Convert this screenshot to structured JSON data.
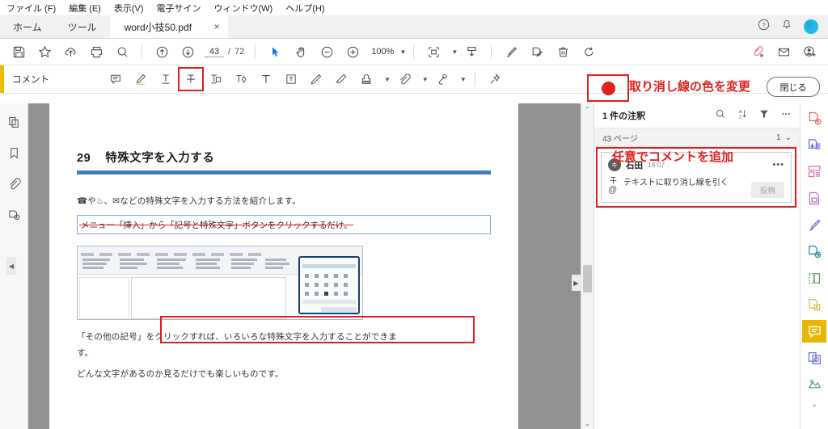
{
  "menubar": {
    "items": [
      "ファイル (F)",
      "編集 (E)",
      "表示(V)",
      "電子サイン",
      "ウィンドウ(W)",
      "ヘルプ(H)"
    ]
  },
  "tabbar": {
    "home": "ホーム",
    "tools": "ツール",
    "document_tab": "word小技50.pdf",
    "close_tab": "×",
    "icons": [
      "help-icon",
      "bell-icon",
      "user-avatar"
    ]
  },
  "toolbar": {
    "icons": [
      "save-icon",
      "star-icon",
      "cloud-upload-icon",
      "print-icon",
      "search-icon",
      "page-up-icon",
      "page-down-icon",
      "select-tool-icon",
      "hand-tool-icon",
      "zoom-out-icon",
      "zoom-in-icon",
      "fit-page-icon",
      "download-page-icon",
      "sign-icon",
      "edit-sign-icon",
      "delete-icon",
      "rotate-icon",
      "share-link-icon",
      "email-icon",
      "add-person-icon"
    ],
    "page_current": "43",
    "page_separator": "/",
    "page_total": "72",
    "zoom_level": "100%"
  },
  "comment_toolbar": {
    "label": "コメント",
    "tools": [
      "sticky-note-icon",
      "highlighter-icon",
      "underline-icon",
      "strikethrough-icon",
      "replace-text-icon",
      "insert-text-icon",
      "add-text-icon",
      "text-box-icon",
      "draw-icon",
      "eraser-icon",
      "stamp-icon",
      "attach-icon",
      "attach-audio-icon",
      "pin-icon"
    ],
    "selected_tool": "strikethrough-icon",
    "color_swatch": "#e2211c",
    "close_label": "閉じる"
  },
  "annotations": {
    "change_color": "取り消し線の色を変更",
    "add_comment": "任意でコメントを追加",
    "color": "#e2211c"
  },
  "left_rail": {
    "items": [
      "page-thumbnails-icon",
      "bookmark-icon",
      "attachment-icon",
      "signature-info-icon"
    ],
    "collapse": "◀"
  },
  "document": {
    "heading_number": "29",
    "heading_text": "特殊文字を入力する",
    "paragraph1": "☎や♨、✉などの特殊文字を入力する方法を紹介します。",
    "paragraph_struck": "メニュー「挿入」から「記号と特殊文字」ボタンをクリックするだけ。",
    "paragraph3": "「その他の記号」をクリックすれば、いろいろな特殊文字を入力することができま",
    "paragraph3_cont": "す。",
    "paragraph4": "どんな文字があるのか見るだけでも楽しいものです。",
    "scroll_up": "⌃",
    "scroll_down": "⌄",
    "collapse_right": "▶"
  },
  "comment_panel": {
    "title": "1 件の注釈",
    "icons": [
      "search-icon",
      "sort-icon",
      "filter-icon",
      "more-options-icon"
    ],
    "page_label": "43 ページ",
    "page_count": "1",
    "page_chevron": "⌄",
    "card": {
      "avatar_initial": "キ",
      "author": "石田",
      "time": "16:07",
      "more": "•••",
      "type_icon": "strikethrough-icon",
      "text": "テキストに取り消し線を引く",
      "mention": "@",
      "post_label": "投稿"
    }
  },
  "right_rail": {
    "items": [
      "create-pdf-icon",
      "export-pdf-icon",
      "organize-pages-icon",
      "compress-file-icon",
      "fill-and-sign-icon",
      "send-for-signature-icon",
      "redact-icon",
      "protect-icon",
      "comment-icon",
      "compare-files-icon",
      "more-tools-icon"
    ],
    "active": "comment-icon",
    "chevron": "⌄"
  }
}
